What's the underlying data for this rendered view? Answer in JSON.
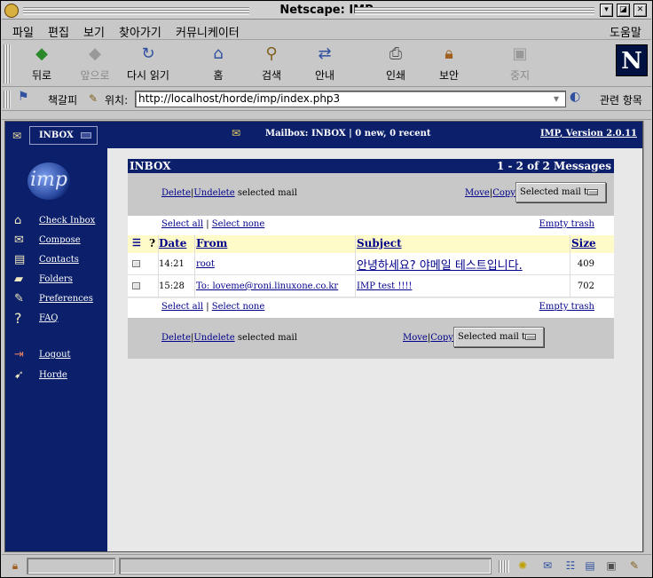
{
  "window": {
    "title": "Netscape: IMP"
  },
  "menubar": {
    "items": [
      "파일",
      "편집",
      "보기",
      "찾아가기",
      "커뮤니케이터"
    ],
    "help": "도움말"
  },
  "toolbar": {
    "buttons": [
      {
        "label": "뒤로",
        "icon": "back-arrow-icon",
        "enabled": true
      },
      {
        "label": "앞으로",
        "icon": "forward-arrow-icon",
        "enabled": false
      },
      {
        "label": "다시 읽기",
        "icon": "reload-icon",
        "enabled": true
      },
      {
        "label": "홈",
        "icon": "home-icon",
        "enabled": true
      },
      {
        "label": "검색",
        "icon": "search-icon",
        "enabled": true
      },
      {
        "label": "안내",
        "icon": "guide-icon",
        "enabled": true
      },
      {
        "label": "인쇄",
        "icon": "print-icon",
        "enabled": true
      },
      {
        "label": "보안",
        "icon": "security-lock-icon",
        "enabled": true
      },
      {
        "label": "중지",
        "icon": "stop-icon",
        "enabled": false
      }
    ]
  },
  "locationbar": {
    "bookmarks_label": "책갈피",
    "location_label": "위치:",
    "url": "http://localhost/horde/imp/index.php3",
    "related_label": "관련 항목"
  },
  "imp": {
    "header": {
      "mailbox_select": "INBOX",
      "status": "Mailbox: INBOX | 0 new, 0 recent",
      "version": "IMP, Version 2.0.11"
    },
    "sidebar": {
      "logo_text": "imp",
      "items": [
        {
          "label": "Check Inbox",
          "icon": "home-icon"
        },
        {
          "label": "Compose",
          "icon": "compose-icon"
        },
        {
          "label": "Contacts",
          "icon": "address-book-icon"
        },
        {
          "label": "Folders",
          "icon": "folder-icon"
        },
        {
          "label": "Preferences",
          "icon": "preferences-icon"
        },
        {
          "label": "FAQ",
          "icon": "question-icon"
        }
      ],
      "bottom_items": [
        {
          "label": "Logout",
          "icon": "logout-icon"
        },
        {
          "label": "Horde",
          "icon": "horde-icon"
        }
      ]
    },
    "inbox_bar": {
      "title": "INBOX",
      "count": "1 - 2 of 2 Messages"
    },
    "actions": {
      "delete": "Delete",
      "undelete": "Undelete",
      "selected_mail": "selected mail",
      "move": "Move",
      "copy": "Copy",
      "selected_mail_to": "Selected mail to:"
    },
    "selection": {
      "select_all": "Select all",
      "select_none": "Select none",
      "empty_trash": "Empty trash"
    },
    "columns": {
      "flag": "?",
      "date": "Date",
      "from": "From",
      "subject": "Subject",
      "size": "Size"
    },
    "messages": [
      {
        "date": "14:21",
        "from": "root",
        "subject": "안녕하세요? 야메일 테스트입니다.",
        "size": "409"
      },
      {
        "date": "15:28",
        "from": "To: loveme@roni.linuxone.co.kr",
        "subject": "IMP test !!!!",
        "size": "702"
      }
    ]
  }
}
